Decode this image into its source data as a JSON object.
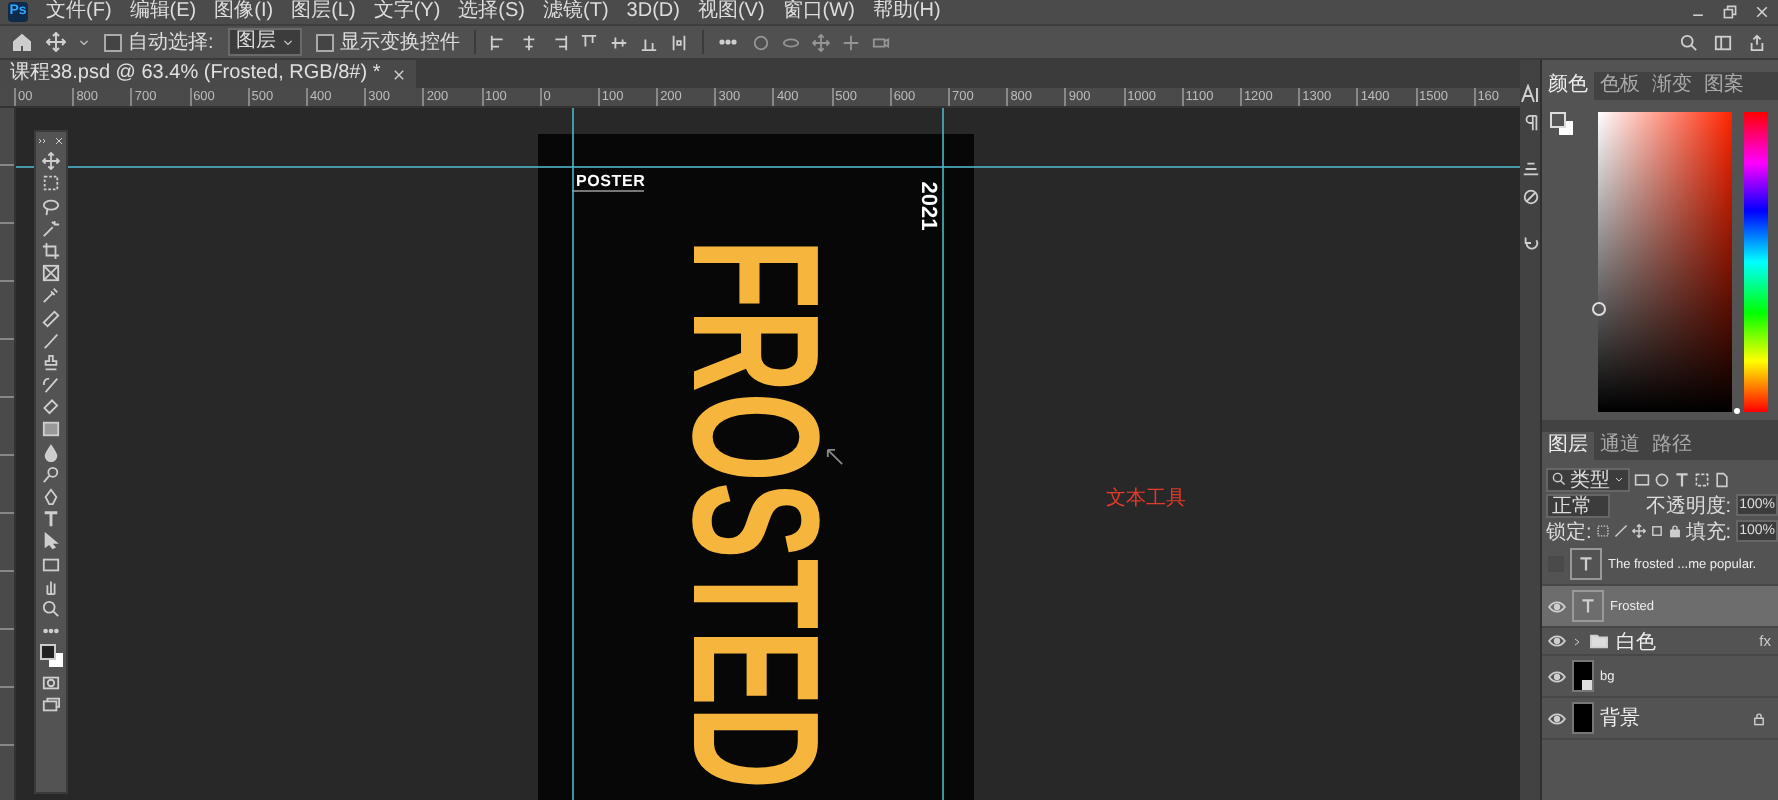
{
  "menu_bar": {
    "logo": "Ps",
    "items": [
      "文件(F)",
      "编辑(E)",
      "图像(I)",
      "图层(L)",
      "文字(Y)",
      "选择(S)",
      "滤镜(T)",
      "3D(D)",
      "视图(V)",
      "窗口(W)",
      "帮助(H)"
    ]
  },
  "options_bar": {
    "auto_select": {
      "label": "自动选择:",
      "checked": false
    },
    "target": {
      "value": "图层"
    },
    "show_transform": {
      "label": "显示变换控件",
      "checked": false
    }
  },
  "document_tab": {
    "title": "课程38.psd @ 63.4% (Frosted, RGB/8#) *"
  },
  "ruler": {
    "labels": [
      "00",
      "800",
      "700",
      "600",
      "500",
      "400",
      "300",
      "200",
      "100",
      "0",
      "100",
      "200",
      "300",
      "400",
      "500",
      "600",
      "700",
      "800",
      "900",
      "1000",
      "1100",
      "1200",
      "1300",
      "1400",
      "1500",
      "160"
    ]
  },
  "canvas": {
    "poster": {
      "title": "POSTER",
      "year": "2021",
      "headline": "FROSTED"
    },
    "annotation": "文本工具"
  },
  "color_panel": {
    "hue_slider": {
      "level": 0
    },
    "tabs": [
      {
        "label": "颜色",
        "selected": true
      },
      {
        "label": "色板",
        "selected": false
      },
      {
        "label": "渐变",
        "selected": false
      },
      {
        "label": "图案",
        "selected": false
      }
    ]
  },
  "layers_panel": {
    "tabs": [
      {
        "label": "图层",
        "selected": true
      },
      {
        "label": "通道",
        "selected": false
      },
      {
        "label": "路径",
        "selected": false
      }
    ],
    "filter": {
      "value": "类型"
    },
    "blend_mode": {
      "value": "正常"
    },
    "opacity": {
      "label": "不透明度:",
      "value": "100%"
    },
    "lock": {
      "label": "锁定:"
    },
    "fill": {
      "label": "填充:",
      "value": "100%"
    },
    "layers": [
      {
        "name": "The frosted ...me popular.",
        "kind": "text",
        "visible": false,
        "selected": false,
        "locked": false
      },
      {
        "name": "Frosted",
        "kind": "text",
        "visible": true,
        "selected": true,
        "locked": false
      },
      {
        "name": "白色",
        "kind": "group",
        "visible": true,
        "selected": false,
        "locked": false,
        "effects": "fx"
      },
      {
        "name": "bg",
        "kind": "smart",
        "visible": true,
        "selected": false,
        "locked": false
      },
      {
        "name": "背景",
        "kind": "background",
        "visible": true,
        "selected": false,
        "locked": true
      }
    ]
  }
}
